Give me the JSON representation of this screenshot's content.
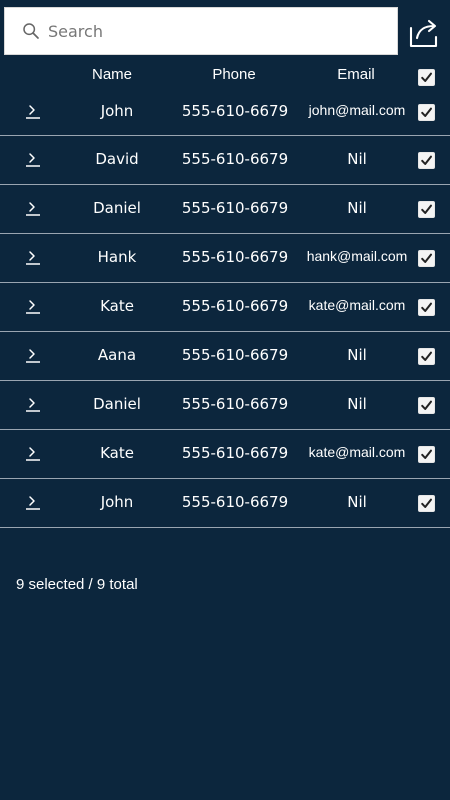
{
  "search": {
    "placeholder": "Search",
    "value": "",
    "icon": "search-icon"
  },
  "toolbar": {
    "share_icon": "share-icon"
  },
  "table": {
    "headers": {
      "name": "Name",
      "phone": "Phone",
      "email": "Email"
    },
    "select_all_checked": true,
    "rows": [
      {
        "name": "John",
        "phone": "555-610-6679",
        "email": "john@mail.com",
        "checked": true
      },
      {
        "name": "David",
        "phone": "555-610-6679",
        "email": "Nil",
        "checked": true
      },
      {
        "name": "Daniel",
        "phone": "555-610-6679",
        "email": "Nil",
        "checked": true
      },
      {
        "name": "Hank",
        "phone": "555-610-6679",
        "email": "hank@mail.com",
        "checked": true
      },
      {
        "name": "Kate",
        "phone": "555-610-6679",
        "email": "kate@mail.com",
        "checked": true
      },
      {
        "name": "Aana",
        "phone": "555-610-6679",
        "email": "Nil",
        "checked": true
      },
      {
        "name": "Daniel",
        "phone": "555-610-6679",
        "email": "Nil",
        "checked": true
      },
      {
        "name": "Kate",
        "phone": "555-610-6679",
        "email": "kate@mail.com",
        "checked": true
      },
      {
        "name": "John",
        "phone": "555-610-6679",
        "email": "Nil",
        "checked": true
      }
    ]
  },
  "footer": {
    "selection_status": "9 selected / 9 total"
  },
  "colors": {
    "background": "#0c263d",
    "text": "#ffffff",
    "divider": "#9aa5b1",
    "search_background": "#ffffff"
  }
}
